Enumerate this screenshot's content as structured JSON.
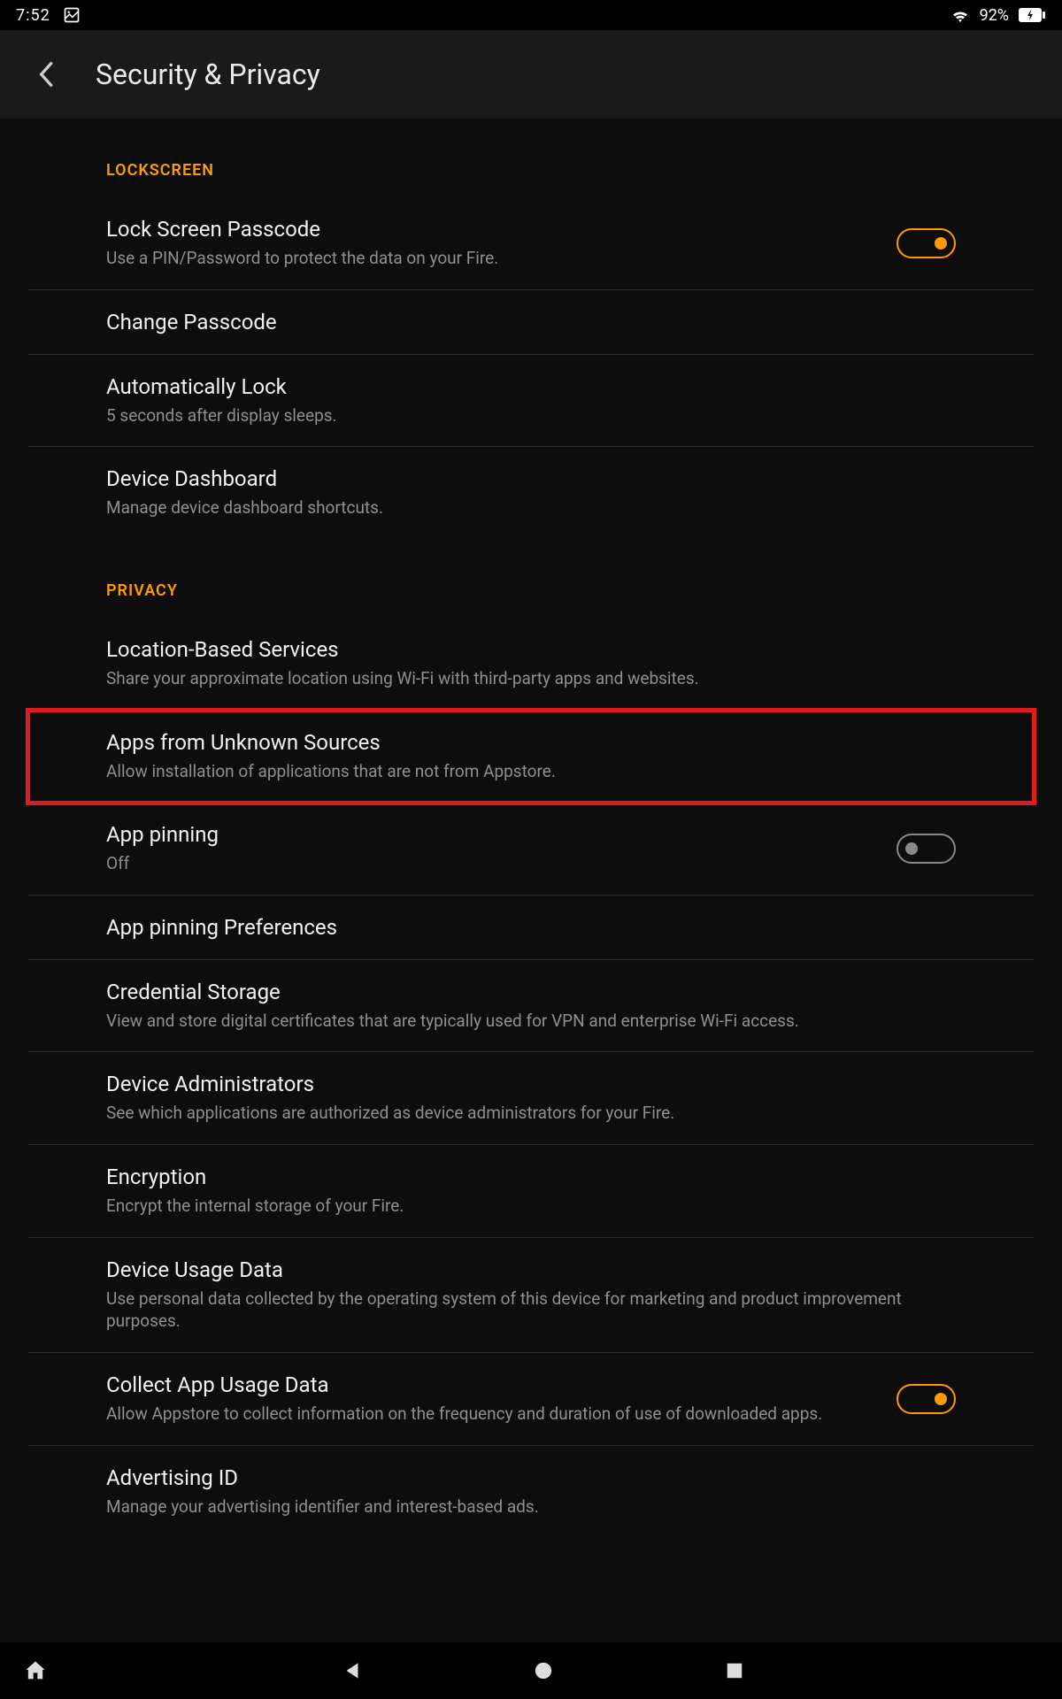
{
  "status": {
    "time": "7:52",
    "battery_pct": "92%"
  },
  "appbar": {
    "title": "Security & Privacy"
  },
  "sections": [
    {
      "header": "LOCKSCREEN",
      "items": [
        {
          "id": "lock-screen-passcode",
          "title": "Lock Screen Passcode",
          "sub": "Use a PIN/Password to protect the data on your Fire.",
          "toggle": "on"
        },
        {
          "id": "change-passcode",
          "title": "Change Passcode",
          "sub": ""
        },
        {
          "id": "automatically-lock",
          "title": "Automatically Lock",
          "sub": "5 seconds after display sleeps."
        },
        {
          "id": "device-dashboard",
          "title": "Device Dashboard",
          "sub": "Manage device dashboard shortcuts."
        }
      ]
    },
    {
      "header": "PRIVACY",
      "items": [
        {
          "id": "location-based-services",
          "title": "Location-Based Services",
          "sub": "Share your approximate location using Wi-Fi with third-party apps and websites."
        },
        {
          "id": "apps-from-unknown-sources",
          "title": "Apps from Unknown Sources",
          "sub": "Allow installation of applications that are not from Appstore.",
          "highlight": true
        },
        {
          "id": "app-pinning",
          "title": "App pinning",
          "sub": "Off",
          "toggle": "off"
        },
        {
          "id": "app-pinning-preferences",
          "title": "App pinning Preferences",
          "sub": ""
        },
        {
          "id": "credential-storage",
          "title": "Credential Storage",
          "sub": "View and store digital certificates that are typically used for VPN and enterprise Wi-Fi access."
        },
        {
          "id": "device-administrators",
          "title": "Device Administrators",
          "sub": "See which applications are authorized as device administrators for your Fire."
        },
        {
          "id": "encryption",
          "title": "Encryption",
          "sub": "Encrypt the internal storage of your Fire."
        },
        {
          "id": "device-usage-data",
          "title": "Device Usage Data",
          "sub": "Use personal data collected by the operating system of this device for marketing and product improvement purposes."
        },
        {
          "id": "collect-app-usage-data",
          "title": "Collect App Usage Data",
          "sub": "Allow Appstore to collect information on the frequency and duration of use of downloaded apps.",
          "toggle": "on"
        },
        {
          "id": "advertising-id",
          "title": "Advertising ID",
          "sub": "Manage your advertising identifier and interest-based ads."
        }
      ]
    }
  ]
}
